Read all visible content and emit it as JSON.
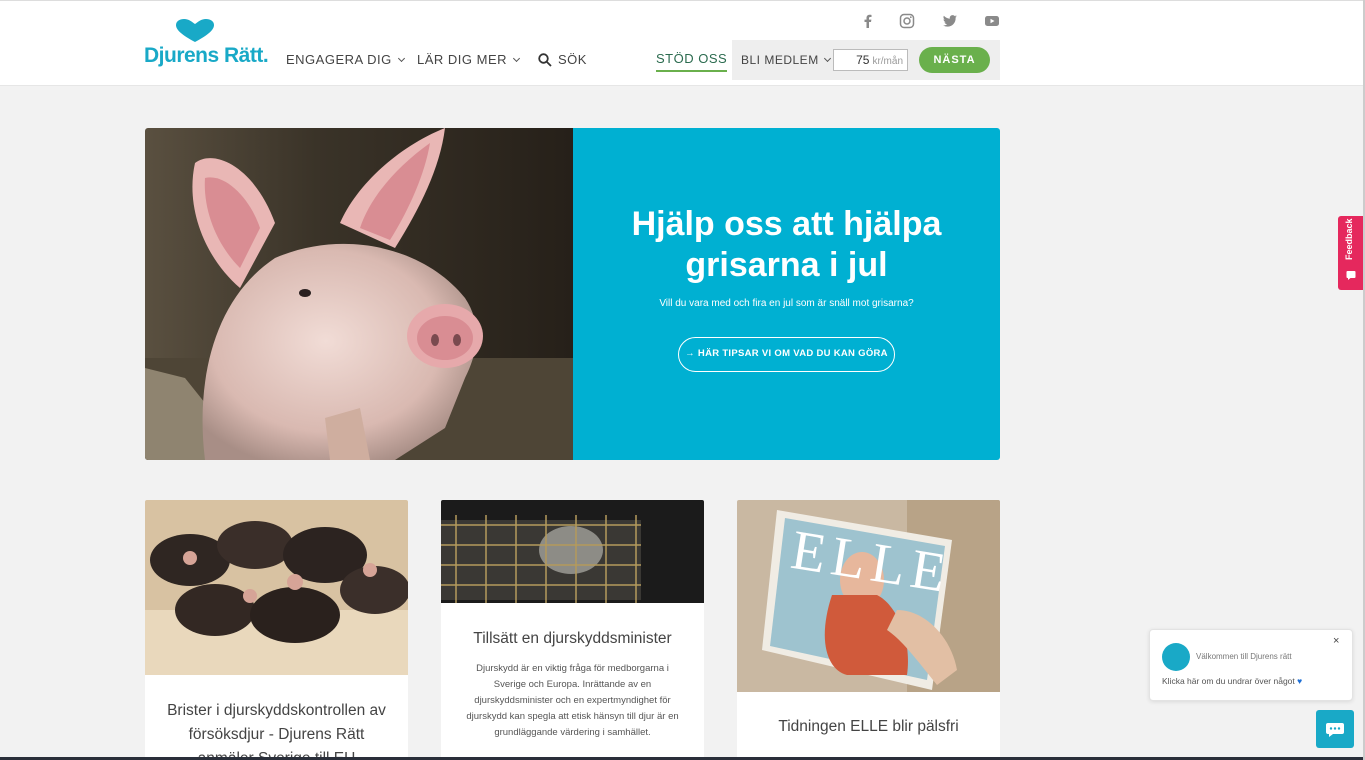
{
  "header": {
    "logo_text": "Djurens Rätt.",
    "nav": [
      {
        "label": "ENGAGERA DIG"
      },
      {
        "label": "LÄR DIG MER"
      },
      {
        "label": "SÖK"
      }
    ],
    "support_label": "STÖD OSS",
    "member_label": "BLI MEDLEM",
    "amount_value": "75",
    "amount_unit": "kr/mån",
    "next_label": "NÄSTA",
    "social_icons": [
      "facebook-icon",
      "instagram-icon",
      "twitter-icon",
      "youtube-icon"
    ],
    "colors": {
      "brand": "#19a9c7",
      "accent": "#6ab04c"
    }
  },
  "hero": {
    "title": "Hjälp oss att hjälpa grisarna i jul",
    "subtitle": "Vill du vara med och fira en jul som är snäll mot grisarna?",
    "button_label": "HÄR TIPSAR VI OM VAD DU KAN GÖRA",
    "color": "#00b0d2"
  },
  "cards": [
    {
      "title": "Brister i djurskyddskontrollen av försöksdjur - Djurens Rätt anmäler Sverige till EU"
    },
    {
      "title": "Tillsätt en djurskyddsminister",
      "text": "Djurskydd är en viktig fråga för medborgarna i Sverige och Europa. Inrättande av en djurskyddsminister och en expertmyndighet för djurskydd kan spegla att etisk hänsyn till djur är en grundläggande värdering i samhället."
    },
    {
      "title": "Tidningen ELLE blir pälsfri",
      "magazine": "ELLE"
    }
  ],
  "feedback_label": "Feedback",
  "chat": {
    "welcome": "Välkommen till Djurens rätt",
    "message": "Klicka här om du undrar över något",
    "close": "×"
  }
}
